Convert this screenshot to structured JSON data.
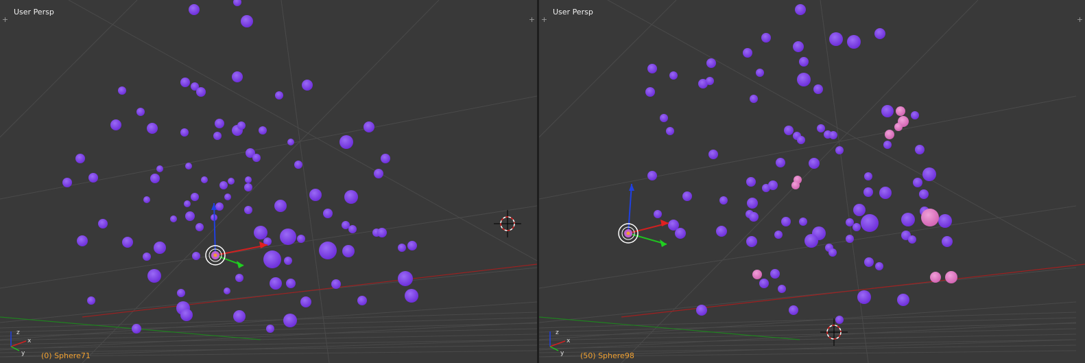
{
  "viewports": [
    {
      "id": "left",
      "view_label": "User Persp",
      "status_text": "(0) Sphere71",
      "axis_labels": {
        "x": "x",
        "y": "y",
        "z": "z"
      }
    },
    {
      "id": "right",
      "view_label": "User Persp",
      "status_text": "(50) Sphere98",
      "axis_labels": {
        "x": "x",
        "y": "y",
        "z": "z"
      }
    }
  ],
  "colors": {
    "viewport_bg": "#393939",
    "grid": "#4a4a4a",
    "x_axis": "#a02020",
    "y_axis": "#208020",
    "sphere": "#6a2ad8",
    "sphere_selected": "#d060b0",
    "status_text": "#f0a030"
  },
  "icons": {
    "corner_widget": "plus-icon",
    "cursor": "3d-cursor-icon",
    "manipulator": "transform-manipulator-icon",
    "orientation": "axis-gizmo-icon"
  }
}
